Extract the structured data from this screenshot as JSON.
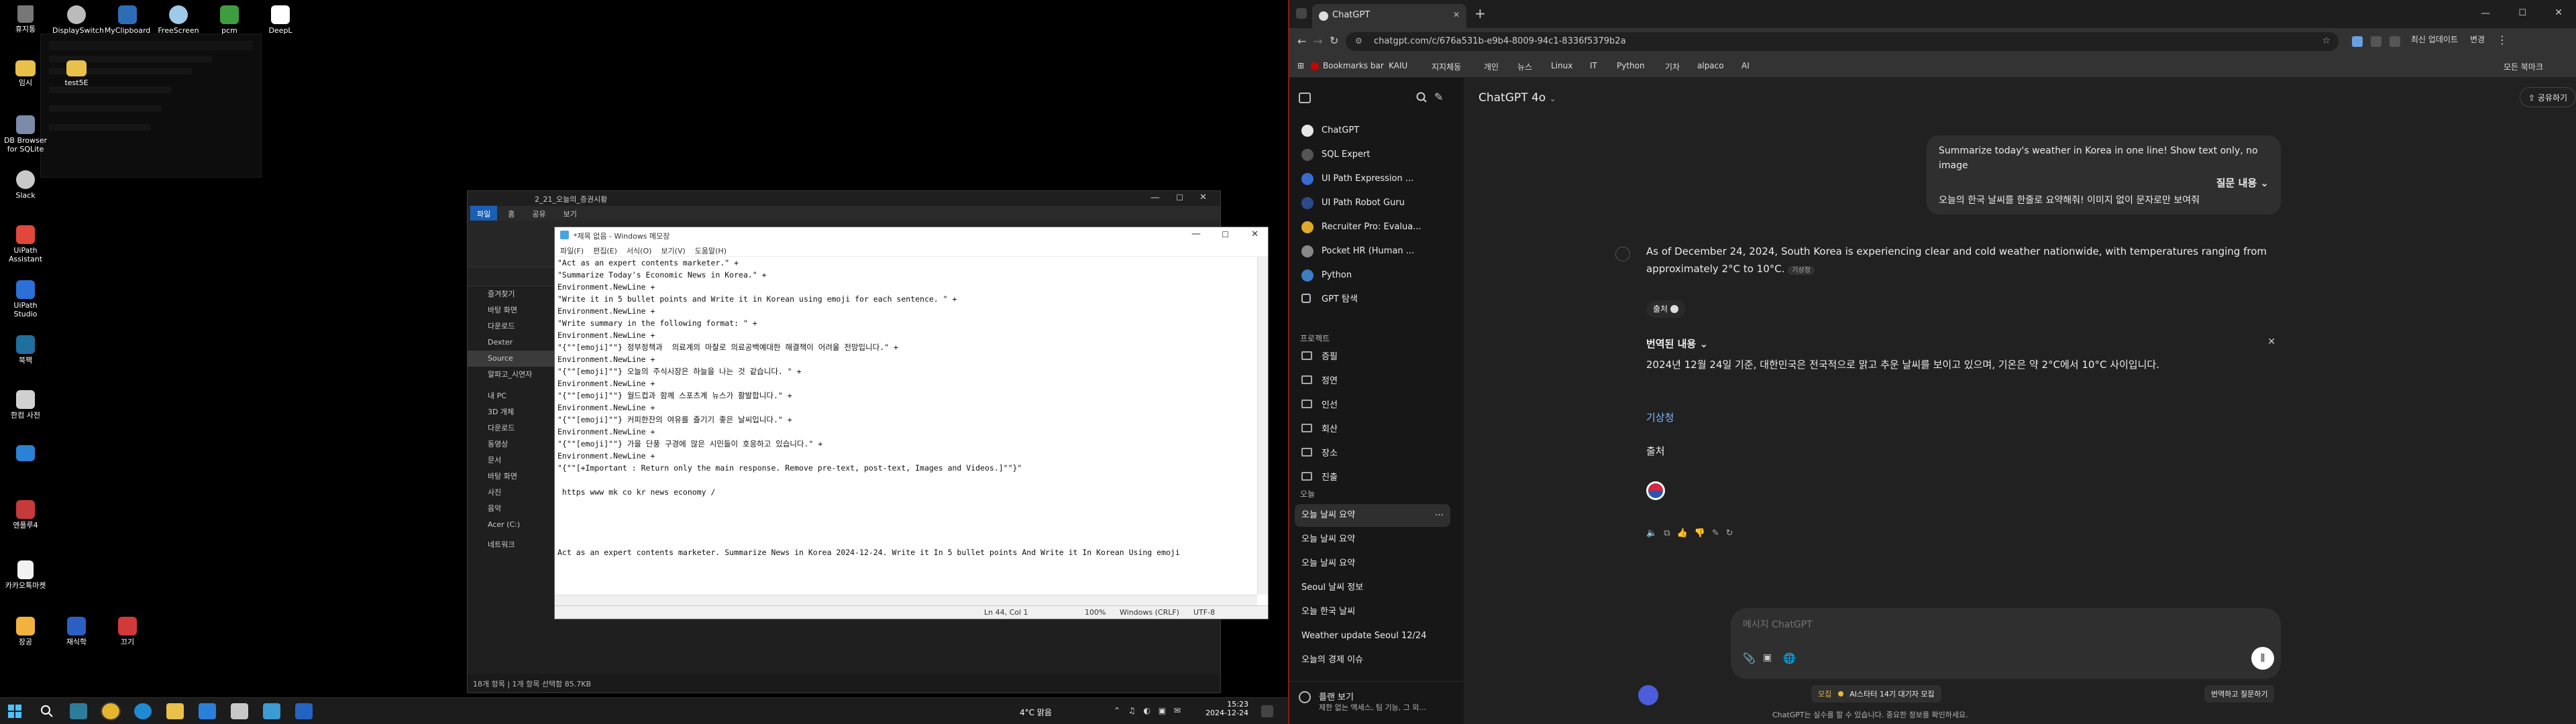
{
  "desktop": {
    "icons": [
      {
        "label": "휴지통"
      },
      {
        "label": "DisplaySwitch"
      },
      {
        "label": "MyClipboard"
      },
      {
        "label": "FreeScreen"
      },
      {
        "label": "pcm"
      },
      {
        "label": "DeepL"
      },
      {
        "label": "임시"
      },
      {
        "label": "test5E"
      },
      {
        "label": "DB Browser for SQLite"
      },
      {
        "label": "Slack"
      },
      {
        "label": "UiPath Assistant"
      },
      {
        "label": "UiPath Studio"
      },
      {
        "label": "북팩"
      },
      {
        "label": "한컴 사전"
      },
      {
        "label": "엔플루4"
      },
      {
        "label": "카카오톡마켓"
      },
      {
        "label": "장공"
      },
      {
        "label": "재식학"
      },
      {
        "label": "끄기"
      }
    ]
  },
  "explorer": {
    "title": "2_21_오늘의_증권시황",
    "tabs": [
      "파일",
      "홈",
      "공유",
      "보기"
    ],
    "nav_items": [
      "즐겨찾기",
      "바탕 화면",
      "다운로드",
      "Dexter",
      "Source",
      "알파고_시연자",
      "내 PC",
      "3D 개체",
      "다운로드",
      "동영상",
      "문서",
      "바탕 화면",
      "사진",
      "음악",
      "Acer (C:)",
      "네트워크"
    ],
    "status_text": "18개 항목  |  1개 항목 선택함 85.7KB"
  },
  "notepad": {
    "title": "*제목 없음 - Windows 메모장",
    "menu": [
      "파일(F)",
      "편집(E)",
      "서식(O)",
      "보기(V)",
      "도움말(H)"
    ],
    "lines": [
      "\"Act as an expert contents marketer.\" +",
      "\"Summarize Today's Economic News in Korea.\" +",
      "Environment.NewLine +",
      "\"Write it in 5 bullet points and Write it in Korean using emoji for each sentence. \" +",
      "Environment.NewLine +",
      "\"Write summary in the following format: \" +",
      "Environment.NewLine +",
      "\"{\"\"[emoji]\"\"} 정부정책과  의료계의 마찰로 의료공백예대한 해결책이 어려울 전망입니다.\" +",
      "Environment.NewLine +",
      "\"{\"\"[emoji]\"\"} 오늘의 주식시장은 하늘을 나는 것 같습니다. \" +",
      "Environment.NewLine +",
      "\"{\"\"[emoji]\"\"} 월드컵과 함께 스포츠계 뉴스가 활발합니다.\" +",
      "Environment.NewLine +",
      "\"{\"\"[emoji]\"\"} 커피한잔의 여유를 즐기기 좋은 날씨입니다.\" +",
      "Environment.NewLine +",
      "\"{\"\"[emoji]\"\"} 가을 단풍 구경에 많은 시민들이 호응하고 있습니다.\" +",
      "Environment.NewLine +",
      "\"{\"\"[+Important : Return only the main response. Remove pre-text, post-text, Images and Videos.]\"\"}\"",
      "",
      " https www mk co kr news economy /",
      "",
      "",
      "",
      "",
      "Act as an expert contents marketer. Summarize News in Korea 2024-12-24. Write it In 5 bullet points And Write it In Korean Using emoji"
    ],
    "status": {
      "position": "Ln 44, Col 1",
      "zoom": "100%",
      "eol": "Windows (CRLF)",
      "encoding": "UTF-8"
    }
  },
  "taskbar": {
    "weather": "4°C  맑음",
    "time": "15:23",
    "date": "2024-12-24"
  },
  "chrome": {
    "tab_title": "ChatGPT",
    "url": "chatgpt.com/c/676a531b-e9b4-8009-94c1-8336f5379b2a",
    "profile_label": "최신 업데이트",
    "menu_label": "변경",
    "bookmarks": [
      "Bookmarks bar",
      "KAIU",
      "지지체동",
      "개인",
      "뉴스",
      "Linux",
      "IT",
      "Python",
      "기차",
      "alpaco",
      "AI"
    ],
    "all_bookmarks": "모든 북마크"
  },
  "chatgpt": {
    "sidebar_items": [
      "ChatGPT",
      "SQL Expert",
      "UI Path Expression ...",
      "UI Path Robot Guru",
      "Recruiter Pro: Evalua...",
      "Pocket HR (Human ...",
      "Python",
      "GPT 탐색"
    ],
    "projects_label": "프로젝트",
    "projects": [
      "증필",
      "정연",
      "인선",
      "회산",
      "장소",
      "진출"
    ],
    "today_label": "오늘",
    "chats": [
      "오늘 날씨 요약",
      "오늘 날씨 요약",
      "오늘 날씨 요약",
      "Seoul 날씨 정보",
      "오늘 한국 날씨",
      "Weather update Seoul 12/24",
      "오늘의 경제 이슈"
    ],
    "upgrade_title": "플랜 보기",
    "upgrade_sub": "제한 없는 액세스, 팀 기능, 그 외...",
    "model": "ChatGPT 4o",
    "share": "공유하기",
    "avatar": "M",
    "user_message": "Summarize today's weather in Korea in one line! Show text only, no image",
    "question_label": "질문 내용",
    "question_text": "오늘의 한국 날씨를 한줄로 요약해줘! 이미지 없이 문자로만 보여줘",
    "answer": "As of December 24, 2024, South Korea is experiencing clear and cold weather nationwide, with temperatures ranging from approximately 2°C to 10°C.",
    "source_tag": "기상청",
    "source_btn": "출처",
    "translated_label": "번역된 내용",
    "translated": "2024년 12월 24일 기준, 대한민국은 전국적으로 맑고 추운 날씨를 보이고 있으며, 기온은 약 2°C에서 10°C 사이입니다.",
    "source_link": "기상청",
    "source_heading": "출처",
    "placeholder": "메시지 ChatGPT",
    "promo_badge": "모집",
    "promo_text": "AI스타터 14기 대기자 모집",
    "translate_btn": "번역하고 질문하기",
    "disclaimer": "ChatGPT는 실수를 할 수 있습니다. 중요한 정보를 확인하세요."
  }
}
